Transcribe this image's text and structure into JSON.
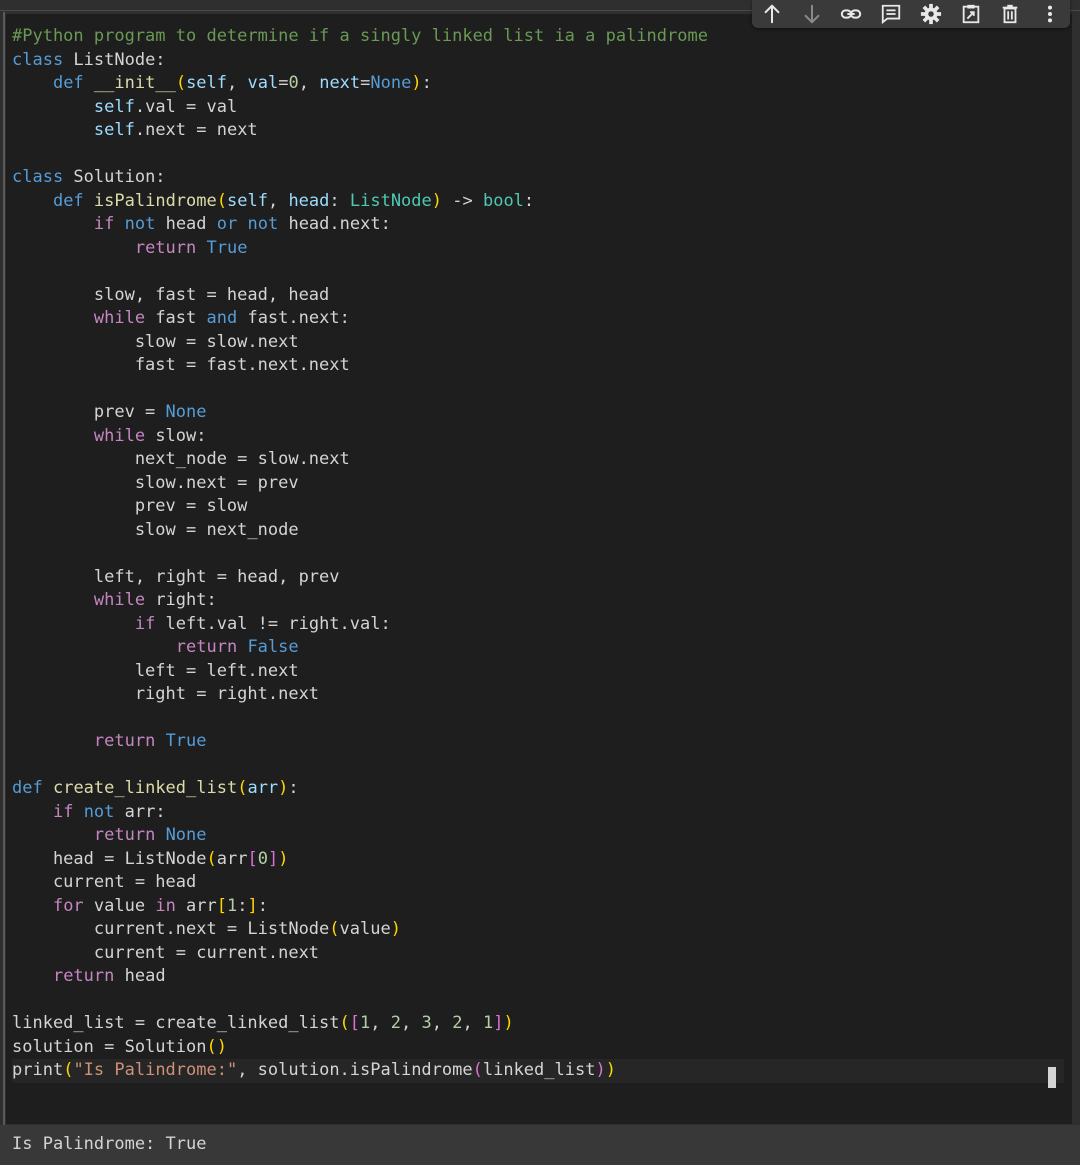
{
  "toolbar": {
    "buttons": [
      {
        "name": "move-up-icon",
        "label": "Move cell up"
      },
      {
        "name": "move-down-icon",
        "label": "Move cell down"
      },
      {
        "name": "link-icon",
        "label": "Copy link to cell"
      },
      {
        "name": "comment-icon",
        "label": "Add comment"
      },
      {
        "name": "gear-icon",
        "label": "Editor settings"
      },
      {
        "name": "mirror-cell-icon",
        "label": "Mirror cell in tab"
      },
      {
        "name": "trash-icon",
        "label": "Delete cell"
      },
      {
        "name": "more-vert-icon",
        "label": "More cell actions"
      }
    ]
  },
  "editor": {
    "lines": [
      [
        [
          "cmt",
          "#Python program to determine if a singly linked list ia a palindrome"
        ]
      ],
      [
        [
          "def",
          "class"
        ],
        [
          "plain",
          " ListNode:"
        ]
      ],
      [
        [
          "plain",
          "    "
        ],
        [
          "def",
          "def"
        ],
        [
          "plain",
          " "
        ],
        [
          "fn",
          "__init__"
        ],
        [
          "p1",
          "("
        ],
        [
          "self",
          "self"
        ],
        [
          "plain",
          ", "
        ],
        [
          "self",
          "val"
        ],
        [
          "op",
          "="
        ],
        [
          "num",
          "0"
        ],
        [
          "plain",
          ", "
        ],
        [
          "self",
          "next"
        ],
        [
          "op",
          "="
        ],
        [
          "const",
          "None"
        ],
        [
          "p1",
          ")"
        ],
        [
          "plain",
          ":"
        ]
      ],
      [
        [
          "plain",
          "        "
        ],
        [
          "self",
          "self"
        ],
        [
          "plain",
          ".val = val"
        ]
      ],
      [
        [
          "plain",
          "        "
        ],
        [
          "self",
          "self"
        ],
        [
          "plain",
          ".next = next"
        ]
      ],
      [
        [
          "plain",
          ""
        ]
      ],
      [
        [
          "def",
          "class"
        ],
        [
          "plain",
          " Solution:"
        ]
      ],
      [
        [
          "plain",
          "    "
        ],
        [
          "def",
          "def"
        ],
        [
          "plain",
          " "
        ],
        [
          "fn",
          "isPalindrome"
        ],
        [
          "p1",
          "("
        ],
        [
          "self",
          "self"
        ],
        [
          "plain",
          ", "
        ],
        [
          "self",
          "head"
        ],
        [
          "plain",
          ": "
        ],
        [
          "cls",
          "ListNode"
        ],
        [
          "p1",
          ")"
        ],
        [
          "plain",
          " -> "
        ],
        [
          "cls",
          "bool"
        ],
        [
          "plain",
          ":"
        ]
      ],
      [
        [
          "plain",
          "        "
        ],
        [
          "kw",
          "if"
        ],
        [
          "plain",
          " "
        ],
        [
          "def",
          "not"
        ],
        [
          "plain",
          " head "
        ],
        [
          "def",
          "or"
        ],
        [
          "plain",
          " "
        ],
        [
          "def",
          "not"
        ],
        [
          "plain",
          " head.next:"
        ]
      ],
      [
        [
          "plain",
          "            "
        ],
        [
          "kw",
          "return"
        ],
        [
          "plain",
          " "
        ],
        [
          "const",
          "True"
        ]
      ],
      [
        [
          "plain",
          ""
        ]
      ],
      [
        [
          "plain",
          "        slow, fast = head, head"
        ]
      ],
      [
        [
          "plain",
          "        "
        ],
        [
          "kw",
          "while"
        ],
        [
          "plain",
          " fast "
        ],
        [
          "def",
          "and"
        ],
        [
          "plain",
          " fast.next:"
        ]
      ],
      [
        [
          "plain",
          "            slow = slow.next"
        ]
      ],
      [
        [
          "plain",
          "            fast = fast.next.next"
        ]
      ],
      [
        [
          "plain",
          ""
        ]
      ],
      [
        [
          "plain",
          "        prev = "
        ],
        [
          "const",
          "None"
        ]
      ],
      [
        [
          "plain",
          "        "
        ],
        [
          "kw",
          "while"
        ],
        [
          "plain",
          " slow:"
        ]
      ],
      [
        [
          "plain",
          "            next_node = slow.next"
        ]
      ],
      [
        [
          "plain",
          "            slow.next = prev"
        ]
      ],
      [
        [
          "plain",
          "            prev = slow"
        ]
      ],
      [
        [
          "plain",
          "            slow = next_node"
        ]
      ],
      [
        [
          "plain",
          ""
        ]
      ],
      [
        [
          "plain",
          "        left, right = head, prev"
        ]
      ],
      [
        [
          "plain",
          "        "
        ],
        [
          "kw",
          "while"
        ],
        [
          "plain",
          " right:"
        ]
      ],
      [
        [
          "plain",
          "            "
        ],
        [
          "kw",
          "if"
        ],
        [
          "plain",
          " left.val != right.val:"
        ]
      ],
      [
        [
          "plain",
          "                "
        ],
        [
          "kw",
          "return"
        ],
        [
          "plain",
          " "
        ],
        [
          "const",
          "False"
        ]
      ],
      [
        [
          "plain",
          "            left = left.next"
        ]
      ],
      [
        [
          "plain",
          "            right = right.next"
        ]
      ],
      [
        [
          "plain",
          ""
        ]
      ],
      [
        [
          "plain",
          "        "
        ],
        [
          "kw",
          "return"
        ],
        [
          "plain",
          " "
        ],
        [
          "const",
          "True"
        ]
      ],
      [
        [
          "plain",
          ""
        ]
      ],
      [
        [
          "def",
          "def"
        ],
        [
          "plain",
          " "
        ],
        [
          "fn",
          "create_linked_list"
        ],
        [
          "p1",
          "("
        ],
        [
          "self",
          "arr"
        ],
        [
          "p1",
          ")"
        ],
        [
          "plain",
          ":"
        ]
      ],
      [
        [
          "plain",
          "    "
        ],
        [
          "kw",
          "if"
        ],
        [
          "plain",
          " "
        ],
        [
          "def",
          "not"
        ],
        [
          "plain",
          " arr:"
        ]
      ],
      [
        [
          "plain",
          "        "
        ],
        [
          "kw",
          "return"
        ],
        [
          "plain",
          " "
        ],
        [
          "const",
          "None"
        ]
      ],
      [
        [
          "plain",
          "    head = ListNode"
        ],
        [
          "p1",
          "("
        ],
        [
          "plain",
          "arr"
        ],
        [
          "p2",
          "["
        ],
        [
          "num",
          "0"
        ],
        [
          "p2",
          "]"
        ],
        [
          "p1",
          ")"
        ]
      ],
      [
        [
          "plain",
          "    current = head"
        ]
      ],
      [
        [
          "plain",
          "    "
        ],
        [
          "kw",
          "for"
        ],
        [
          "plain",
          " value "
        ],
        [
          "kw",
          "in"
        ],
        [
          "plain",
          " arr"
        ],
        [
          "p1",
          "["
        ],
        [
          "num",
          "1"
        ],
        [
          "plain",
          ":"
        ],
        [
          "p1",
          "]"
        ],
        [
          "plain",
          ":"
        ]
      ],
      [
        [
          "plain",
          "        current.next = ListNode"
        ],
        [
          "p1",
          "("
        ],
        [
          "plain",
          "value"
        ],
        [
          "p1",
          ")"
        ]
      ],
      [
        [
          "plain",
          "        current = current.next"
        ]
      ],
      [
        [
          "plain",
          "    "
        ],
        [
          "kw",
          "return"
        ],
        [
          "plain",
          " head"
        ]
      ],
      [
        [
          "plain",
          ""
        ]
      ],
      [
        [
          "plain",
          "linked_list = create_linked_list"
        ],
        [
          "p1",
          "("
        ],
        [
          "p2",
          "["
        ],
        [
          "num",
          "1"
        ],
        [
          "plain",
          ", "
        ],
        [
          "num",
          "2"
        ],
        [
          "plain",
          ", "
        ],
        [
          "num",
          "3"
        ],
        [
          "plain",
          ", "
        ],
        [
          "num",
          "2"
        ],
        [
          "plain",
          ", "
        ],
        [
          "num",
          "1"
        ],
        [
          "p2",
          "]"
        ],
        [
          "p1",
          ")"
        ]
      ],
      [
        [
          "plain",
          "solution = Solution"
        ],
        [
          "p1",
          "()"
        ]
      ],
      [
        [
          "plain",
          "print"
        ],
        [
          "p1",
          "("
        ],
        [
          "str",
          "\"Is Palindrome:\""
        ],
        [
          "plain",
          ", solution.isPalindrome"
        ],
        [
          "p2",
          "("
        ],
        [
          "plain",
          "linked_list"
        ],
        [
          "p2",
          ")"
        ],
        [
          "p1",
          ")"
        ]
      ]
    ],
    "active_line": 44
  },
  "output": {
    "text": "Is Palindrome: True"
  }
}
